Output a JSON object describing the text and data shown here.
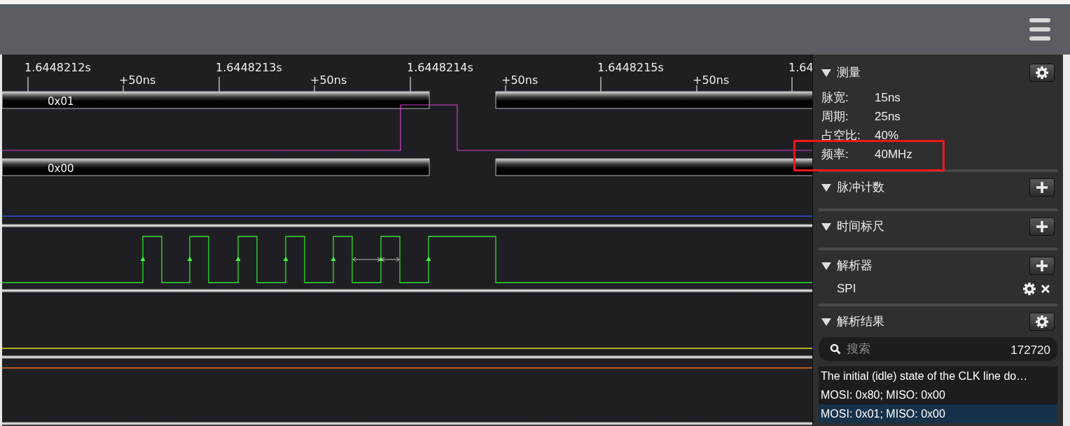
{
  "ruler": {
    "major": [
      "1.6448212s",
      "1.6448213s",
      "1.6448214s",
      "1.6448215s",
      "1.64"
    ],
    "minor": [
      "+50ns",
      "+50ns",
      "+50ns",
      "+50ns"
    ]
  },
  "buses": [
    {
      "value": "0x01"
    },
    {
      "value": "0x00"
    }
  ],
  "panel": {
    "sections": [
      {
        "kind": "measure",
        "title": "测量",
        "expanded": true,
        "rows": [
          {
            "label": "脉宽:",
            "value": "15ns",
            "highlighted": false
          },
          {
            "label": "周期:",
            "value": "25ns",
            "highlighted": false
          },
          {
            "label": "占空比:",
            "value": "40%",
            "highlighted": false
          },
          {
            "label": "频率:",
            "value": "40MHz",
            "highlighted": true
          }
        ]
      },
      {
        "kind": "plain",
        "title": "脉冲计数",
        "expanded": true
      },
      {
        "kind": "plain",
        "title": "时间标尺",
        "expanded": true
      },
      {
        "kind": "analyzers",
        "title": "解析器",
        "expanded": true,
        "items": [
          {
            "name": "SPI"
          }
        ]
      },
      {
        "kind": "results",
        "title": "解析结果",
        "expanded": true,
        "search": {
          "placeholder": "搜索",
          "count": "172720"
        },
        "results": [
          {
            "text": "The initial (idle) state of the CLK line do…",
            "selected": false
          },
          {
            "text": "MOSI: 0x80;  MISO: 0x00",
            "selected": false
          },
          {
            "text": "MOSI: 0x01;  MISO: 0x00",
            "selected": true
          }
        ]
      }
    ]
  }
}
